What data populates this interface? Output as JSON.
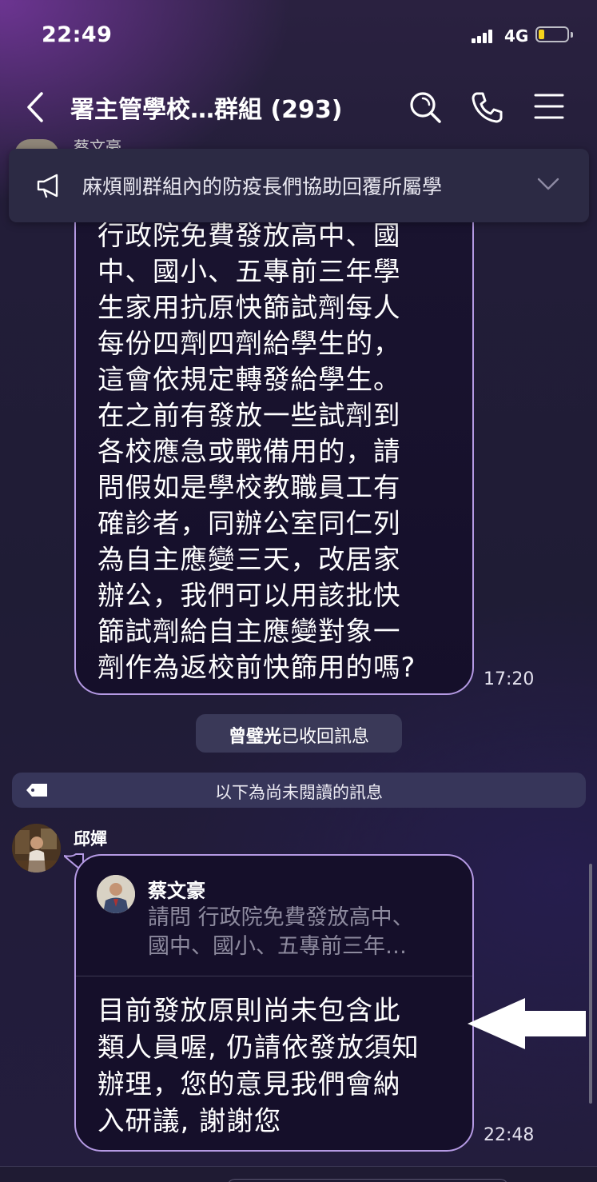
{
  "status_bar": {
    "time": "22:49",
    "network": "4G",
    "battery_level": 0.2,
    "battery_color": "#f6d31b"
  },
  "header": {
    "title": "署主管學校…群組 (293)",
    "icons": [
      "back-icon",
      "search-icon",
      "call-icon",
      "menu-icon"
    ]
  },
  "announcement": {
    "text": "麻煩剛群組內的防疫長們協助回覆所屬學",
    "icon": "megaphone-icon"
  },
  "messages": [
    {
      "sender_partial": "蔡文豪",
      "text": "行政院免費發放高中、國中、國小、五專前三年學生家用抗原快篩試劑每人每份四劑四劑給學生的，這會依規定轉發給學生。在之前有發放一些試劑到各校應急或戰備用的，請問假如是學校教職員工有確診者，同辦公室同仁列為自主應變三天，改居家辦公，我們可以用該批快篩試劑給自主應變對象一劑作為返校前快篩用的嗎?",
      "lines": [
        "行政院免費發放高中、國",
        "中、國小、五專前三年學",
        "生家用抗原快篩試劑每人",
        "每份四劑四劑給學生的，",
        "這會依規定轉發給學生。",
        "在之前有發放一些試劑到",
        "各校應急或戰備用的，請",
        "問假如是學校教職員工有",
        "確診者，同辦公室同仁列",
        "為自主應變三天，改居家",
        "辦公，我們可以用該批快",
        "篩試劑給自主應變對象一",
        "劑作為返校前快篩用的嗎?"
      ],
      "time": "17:20"
    },
    {
      "sender": "邱嬋",
      "reply_to": {
        "name": "蔡文豪",
        "preview_lines": [
          "請問 行政院免費發放高中、",
          "國中、國小、五專前三年…"
        ]
      },
      "lines": [
        "目前發放原則尚未包含此",
        "類人員喔, 仍請依發放須知",
        "辦理，您的意見我們會納",
        "入研議, 謝謝您"
      ],
      "time": "22:48"
    }
  ],
  "recall_notice": {
    "name": "曾璧光",
    "text": "已收回訊息"
  },
  "unread_divider": "以下為尚未閱讀的訊息",
  "colors": {
    "bubble_border": "#b59ae4",
    "bubble_fill": "#150f2a",
    "pill": "#3a3958"
  }
}
